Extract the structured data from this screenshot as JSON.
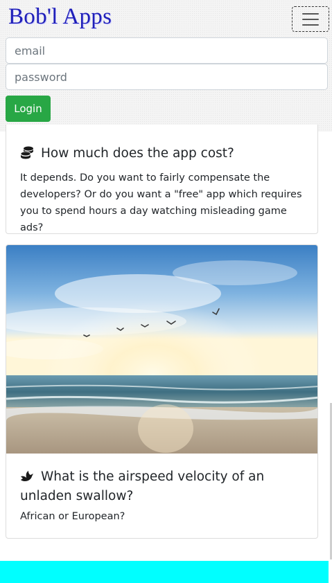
{
  "navbar": {
    "brand": "Bob'l Apps",
    "toggle_icon": "hamburger-menu-icon"
  },
  "login_form": {
    "email_placeholder": "email",
    "password_placeholder": "password",
    "login_label": "Login",
    "login_color": "#28a745"
  },
  "cards": [
    {
      "icon": "coins-icon",
      "title": "How much does the app cost?",
      "text": "It depends. Do you want to fairly compensate the developers? Or do you want a \"free\" app which requires you to spend hours a day watching misleading game ads?"
    },
    {
      "image": "beach-sunset-with-seagulls",
      "icon": "dove-icon",
      "title": "What is the airspeed velocity of an unladen swallow?",
      "text": "African or European?"
    }
  ],
  "footer": {
    "color": "#00ffff"
  }
}
